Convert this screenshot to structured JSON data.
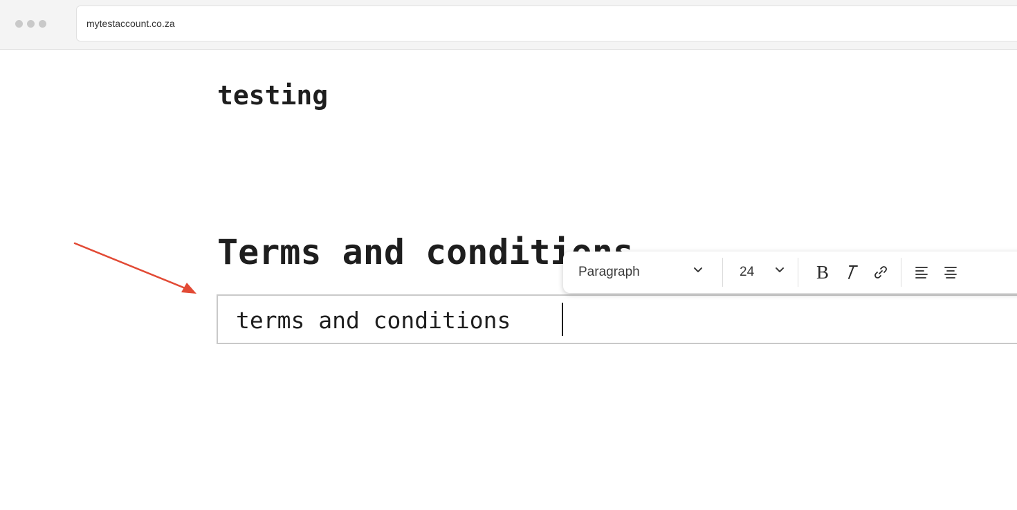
{
  "browser": {
    "url": "mytestaccount.co.za"
  },
  "page": {
    "heading": "testing",
    "section_title": "Terms and conditions",
    "editor_text": "terms and conditions "
  },
  "toolbar": {
    "block_type": "Paragraph",
    "font_size": "24",
    "bold_label": "B",
    "italic_label": "I",
    "icons": [
      "chevron-down-icon",
      "link-icon",
      "align-left-icon",
      "align-center-icon"
    ]
  },
  "annotation": {
    "arrow_color": "#e24a35"
  }
}
